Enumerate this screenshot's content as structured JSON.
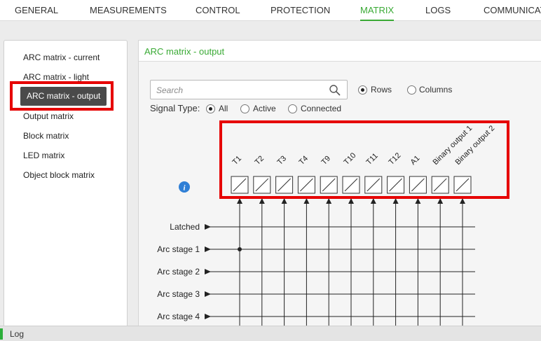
{
  "nav": {
    "tabs": [
      "GENERAL",
      "MEASUREMENTS",
      "CONTROL",
      "PROTECTION",
      "MATRIX",
      "LOGS",
      "COMMUNICAT"
    ],
    "active": "MATRIX"
  },
  "sidebar": {
    "items": [
      "ARC matrix - current",
      "ARC matrix - light",
      "ARC matrix - output",
      "Output matrix",
      "Block matrix",
      "LED matrix",
      "Object block matrix"
    ],
    "selected": "ARC matrix - output"
  },
  "panel": {
    "title": "ARC matrix - output",
    "search": {
      "placeholder": "Search"
    },
    "view_mode": {
      "options": [
        "Rows",
        "Columns"
      ],
      "selected": "Rows"
    },
    "signal_type": {
      "label": "Signal Type:",
      "options": [
        "All",
        "Active",
        "Connected"
      ],
      "selected": "All"
    }
  },
  "matrix": {
    "columns": [
      "T1",
      "T2",
      "T3",
      "T4",
      "T9",
      "T10",
      "T11",
      "T12",
      "A1",
      "Binary output 1",
      "Binary output 2"
    ],
    "rows": [
      "Latched",
      "Arc stage 1",
      "Arc stage 2",
      "Arc stage 3",
      "Arc stage 4"
    ],
    "connections": [
      {
        "row": "Arc stage 1",
        "column": "T1"
      }
    ]
  },
  "log": {
    "label": "Log"
  },
  "colors": {
    "accent": "#3aaa35",
    "highlight": "#e60000",
    "selected_item_bg": "#4a4a4a"
  }
}
